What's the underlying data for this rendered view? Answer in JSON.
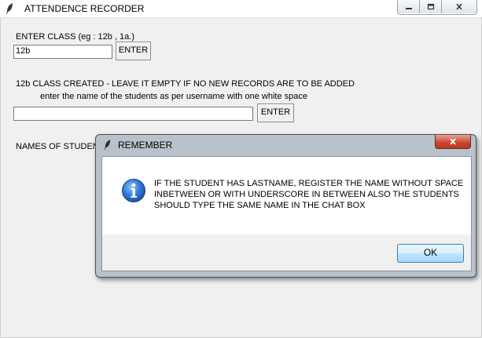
{
  "window": {
    "title": "ATTENDENCE RECORDER",
    "feather_icon": "tk-feather-icon",
    "buttons": [
      "minimize-icon",
      "maximize-icon",
      "close-icon"
    ]
  },
  "form": {
    "class_label": "ENTER CLASS (eg : 12b , 1a.)",
    "class_value": "12b",
    "class_enter": "ENTER",
    "status_line": "12b CLASS CREATED - LEAVE IT EMPTY IF NO NEW RECORDS ARE TO BE ADDED",
    "instruction_line": "enter the name of the students as per username with one white space",
    "student_value": "",
    "student_enter": "ENTER",
    "names_label": "NAMES OF STUDEN"
  },
  "dialog": {
    "title": "REMEMBER",
    "icon": "info-icon",
    "message": "IF THE STUDENT HAS LASTNAME, REGISTER THE NAME WITHOUT SPACE INBETWEEN  OR WITH UNDERSCORE IN BETWEEN  ALSO THE STUDENTS SHOULD TYPE THE SAME NAME IN THE CHAT BOX",
    "ok_label": "OK"
  },
  "colors": {
    "window_bg": "#f0f0f0",
    "dialog_frame": "#b9c2cb",
    "close_red": "#c8432a",
    "info_blue": "#1f5fb5"
  }
}
